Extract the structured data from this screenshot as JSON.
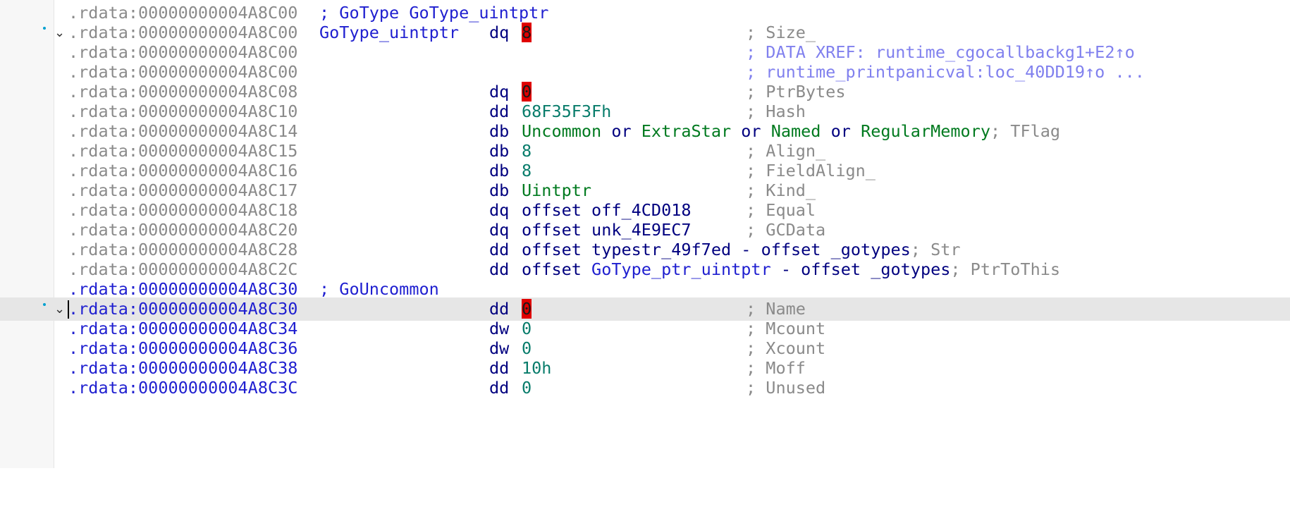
{
  "listing": {
    "rows": [
      {
        "addr": ".rdata:00000000004A8C00",
        "header": "; GoType GoType_uintptr"
      },
      {
        "addr": ".rdata:00000000004A8C00",
        "name": "GoType_uintptr",
        "mnemonic": "dq",
        "operand": "8",
        "comment": "; Size_"
      },
      {
        "addr": ".rdata:00000000004A8C00",
        "comment": "; DATA XREF: runtime_cgocallbackg1+E2↑o"
      },
      {
        "addr": ".rdata:00000000004A8C00",
        "comment": "; runtime_printpanicval:loc_40DD19↑o ..."
      },
      {
        "addr": ".rdata:00000000004A8C08",
        "mnemonic": "dq",
        "operand": "0",
        "comment": "; PtrBytes"
      },
      {
        "addr": ".rdata:00000000004A8C10",
        "mnemonic": "dd",
        "operand": "68F35F3Fh",
        "comment": "; Hash"
      },
      {
        "addr": ".rdata:00000000004A8C14",
        "mnemonic": "db",
        "op_parts": [
          "Uncommon",
          " or ",
          "ExtraStar",
          " or ",
          "Named",
          " or ",
          "RegularMemory"
        ],
        "comment": "; TFlag"
      },
      {
        "addr": ".rdata:00000000004A8C15",
        "mnemonic": "db",
        "operand": "8",
        "comment": "; Align_"
      },
      {
        "addr": ".rdata:00000000004A8C16",
        "mnemonic": "db",
        "operand": "8",
        "comment": "; FieldAlign_"
      },
      {
        "addr": ".rdata:00000000004A8C17",
        "mnemonic": "db",
        "operand": "Uintptr",
        "comment": "; Kind_"
      },
      {
        "addr": ".rdata:00000000004A8C18",
        "mnemonic": "dq",
        "op_parts": [
          "offset ",
          "off_4CD018"
        ],
        "comment": "; Equal"
      },
      {
        "addr": ".rdata:00000000004A8C20",
        "mnemonic": "dq",
        "op_parts": [
          "offset ",
          "unk_4E9EC7"
        ],
        "comment": "; GCData"
      },
      {
        "addr": ".rdata:00000000004A8C28",
        "mnemonic": "dd",
        "op_parts": [
          "offset ",
          "typestr_49f7ed",
          " - offset ",
          "_gotypes"
        ],
        "comment": "; Str"
      },
      {
        "addr": ".rdata:00000000004A8C2C",
        "mnemonic": "dd",
        "op_parts": [
          "offset ",
          "GoType_ptr_uintptr",
          " - offset ",
          "_gotypes"
        ],
        "comment": "; PtrToThis"
      },
      {
        "addr": ".rdata:00000000004A8C30",
        "header": "; GoUncommon"
      },
      {
        "addr": ".rdata:00000000004A8C30",
        "mnemonic": "dd",
        "operand": "0",
        "comment": "; Name"
      },
      {
        "addr": ".rdata:00000000004A8C34",
        "mnemonic": "dw",
        "operand": "0",
        "comment": "; Mcount"
      },
      {
        "addr": ".rdata:00000000004A8C36",
        "mnemonic": "dw",
        "operand": "0",
        "comment": "; Xcount"
      },
      {
        "addr": ".rdata:00000000004A8C38",
        "mnemonic": "dd",
        "operand": "10h",
        "comment": "; Moff"
      },
      {
        "addr": ".rdata:00000000004A8C3C",
        "mnemonic": "dd",
        "operand": "0",
        "comment": "; Unused"
      }
    ]
  },
  "gutter": {
    "collapse_glyph": "⌄"
  },
  "colors": {
    "address_gray": "#8a8a8a",
    "address_blue": "#1f1fd0",
    "mnemonic": "#00007f",
    "symbol": "#007a1f",
    "number": "#087c6b",
    "xref_comment": "#8080ee",
    "undefined_highlight": "#e00000",
    "selected_line": "#e6e6e6"
  }
}
